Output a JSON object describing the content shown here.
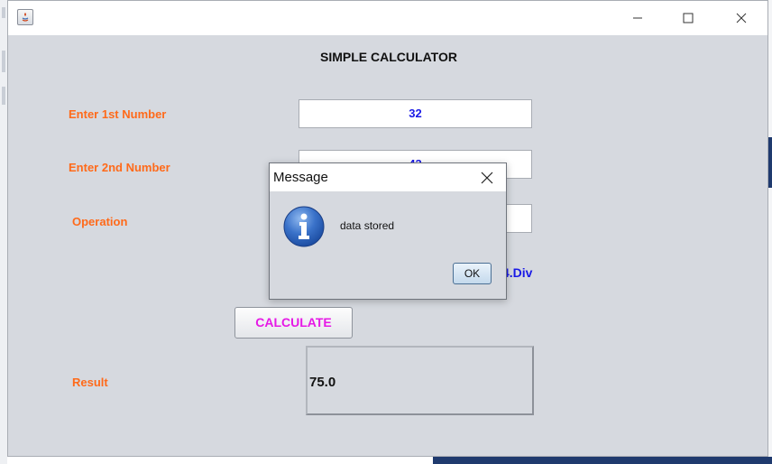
{
  "window": {
    "title": ""
  },
  "heading": "SIMPLE CALCULATOR",
  "form": {
    "first_label": "Enter 1st Number",
    "first_value": "32",
    "second_label": "Enter 2nd Number",
    "second_value": "43",
    "operation_label": "Operation",
    "operation_value": "",
    "operations_hint": "4.Div",
    "calculate_label": "CALCULATE",
    "result_label": "Result",
    "result_value": "75.0"
  },
  "dialog": {
    "title": "Message",
    "message": "data stored",
    "ok_label": "OK",
    "icon": "info-icon"
  },
  "colors": {
    "label": "#ff6a1a",
    "input_text": "#1a1ae6",
    "calculate_text": "#e619e6",
    "window_bg": "#d6d9df"
  }
}
